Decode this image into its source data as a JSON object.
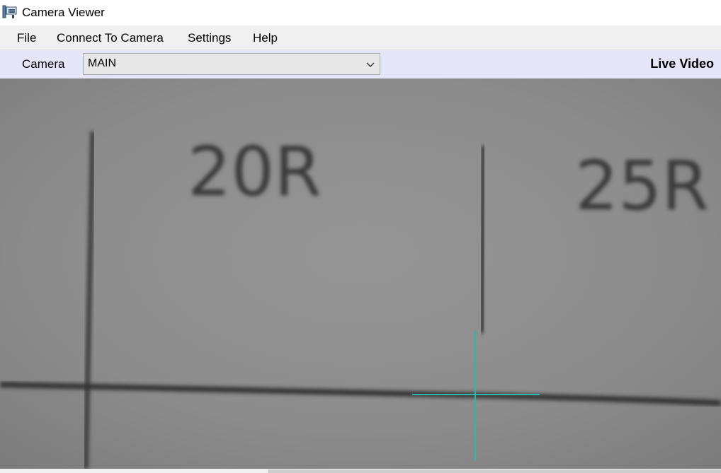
{
  "window": {
    "title": "Camera Viewer",
    "icon": "camera-viewer-app-icon"
  },
  "menu": {
    "file": "File",
    "connect": "Connect To Camera",
    "settings": "Settings",
    "help": "Help"
  },
  "toolbar": {
    "camera_label": "Camera",
    "camera_selected": "MAIN",
    "status": "Live Video"
  },
  "video": {
    "markers": [
      "20R",
      "25R"
    ],
    "crosshair_color": "#2ab8b0"
  },
  "colors": {
    "toolbar_background": "#e6e6fa",
    "menu_background": "#f0f0f0",
    "video_background": "#8b8b8b"
  }
}
